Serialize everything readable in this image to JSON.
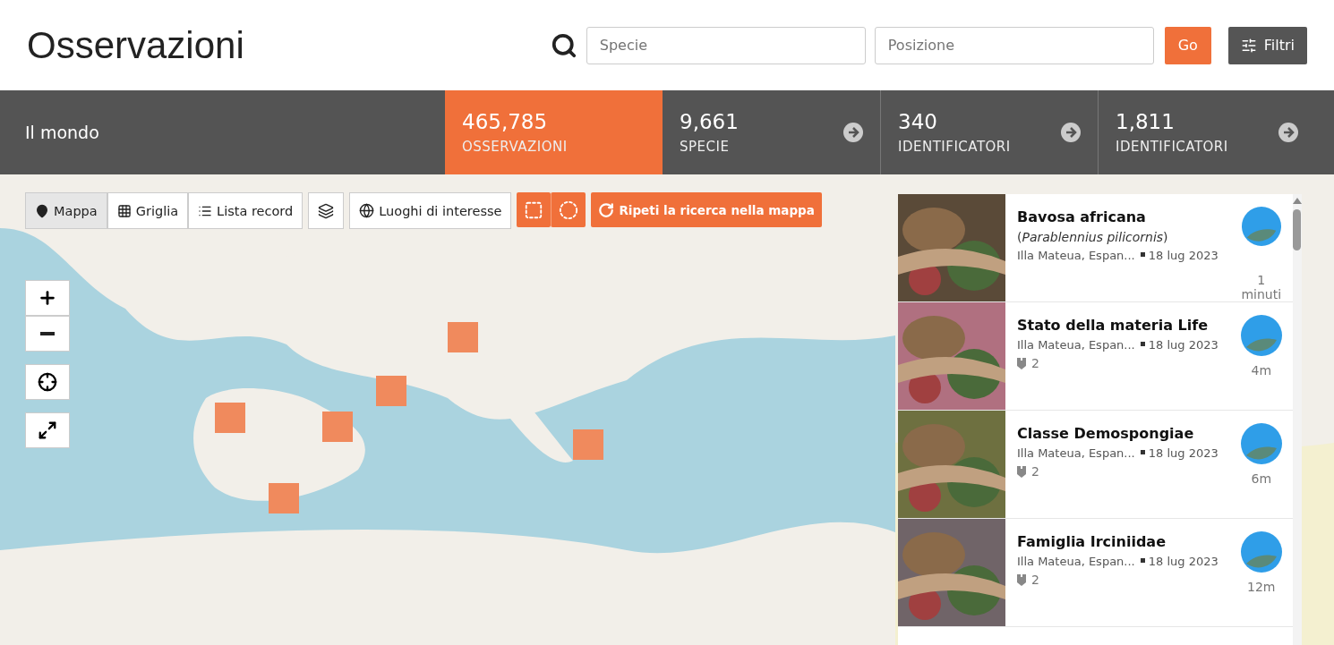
{
  "header": {
    "title": "Osservazioni",
    "species_placeholder": "Specie",
    "location_placeholder": "Posizione",
    "go": "Go",
    "filters": "Filtri"
  },
  "stats_bar": {
    "place": "Il mondo",
    "stats": [
      {
        "value": "465,785",
        "label": "OSSERVAZIONI",
        "selected": true
      },
      {
        "value": "9,661",
        "label": "SPECIE",
        "selected": false
      },
      {
        "value": "340",
        "label": "IDENTIFICATORI",
        "selected": false
      },
      {
        "value": "1,811",
        "label": "IDENTIFICATORI",
        "selected": false
      }
    ]
  },
  "map": {
    "kind": "picture",
    "views": [
      {
        "label": "Mappa",
        "selected": true
      },
      {
        "label": "Griglia",
        "selected": false
      },
      {
        "label": "Lista record",
        "selected": false
      }
    ],
    "places_button": "Luoghi di interesse",
    "redo_button": "Ripeti la ricerca nella mappa"
  },
  "observations": [
    {
      "title": "Bavosa africana",
      "subtitle": "(*Parablennius pilicornis*)",
      "place": "Illa Mateua, Espan...",
      "date": "18 lug 2023",
      "time": "1 minuti"
    },
    {
      "title": "Stato della materia Life",
      "place": "Illa Mateua, Espan...",
      "date": "18 lug 2023",
      "ids": "2",
      "time": "4m"
    },
    {
      "title": "Classe Demospongiae",
      "place": "Illa Mateua, Espan...",
      "date": "18 lug 2023",
      "ids": "2",
      "time": "6m"
    },
    {
      "title": "Famiglia Irciniidae",
      "place": "Illa Mateua, Espan...",
      "date": "18 lug 2023",
      "ids": "2",
      "time": "12m"
    }
  ]
}
